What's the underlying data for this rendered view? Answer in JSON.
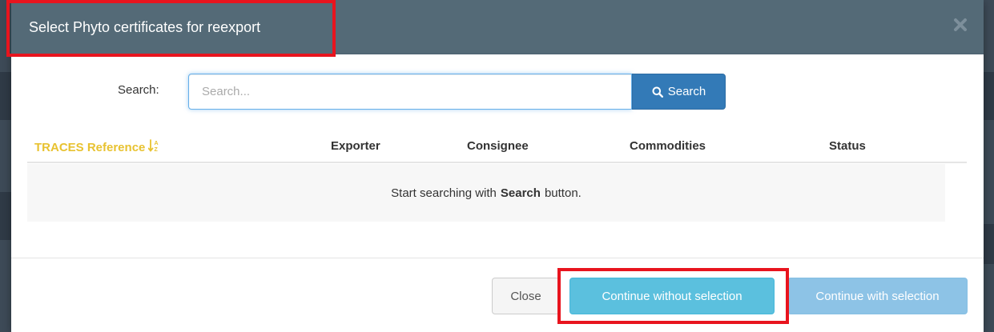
{
  "modal": {
    "title": "Select Phyto certificates for reexport"
  },
  "search": {
    "label": "Search:",
    "placeholder": "Search...",
    "value": "",
    "button_label": "Search"
  },
  "table": {
    "columns": [
      "TRACES Reference",
      "Exporter",
      "Consignee",
      "Commodities",
      "Status"
    ],
    "empty_message_before": "Start searching with",
    "empty_message_bold": "Search",
    "empty_message_after": "button."
  },
  "footer": {
    "close_label": "Close",
    "continue_without_label": "Continue without selection",
    "continue_with_label": "Continue with selection"
  },
  "colors": {
    "header_bg": "#546a77",
    "primary": "#337ab7",
    "info": "#5bc0de",
    "sort_column": "#e8c230",
    "highlight": "#e8141e"
  },
  "icons": {
    "close": "close-icon",
    "search": "magnifier-icon",
    "sort": "sort-alpha-asc-icon"
  }
}
